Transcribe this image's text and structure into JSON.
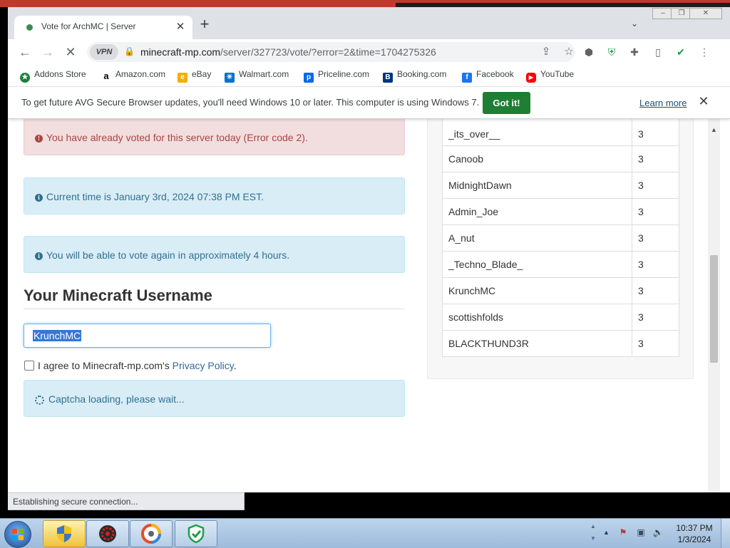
{
  "browser": {
    "tab_title": "Vote for ArchMC | Server",
    "url_domain": "minecraft-mp.com",
    "url_path": "/server/327723/vote/?error=2&time=1704275326",
    "vpn_label": "VPN",
    "status_text": "Establishing secure connection..."
  },
  "bookmarks": [
    {
      "label": "Addons Store",
      "icon": "addons-store-icon",
      "color": "#1b7f3b"
    },
    {
      "label": "Amazon.com",
      "icon": "amazon-icon",
      "color": "#000000"
    },
    {
      "label": "eBay",
      "icon": "ebay-icon",
      "color": "#e53238"
    },
    {
      "label": "Walmart.com",
      "icon": "walmart-icon",
      "color": "#0071ce"
    },
    {
      "label": "Priceline.com",
      "icon": "priceline-icon",
      "color": "#0068ef"
    },
    {
      "label": "Booking.com",
      "icon": "booking-icon",
      "color": "#003580"
    },
    {
      "label": "Facebook",
      "icon": "facebook-icon",
      "color": "#1877f2"
    },
    {
      "label": "YouTube",
      "icon": "youtube-icon",
      "color": "#ff0000"
    }
  ],
  "infobar": {
    "message": "To get future AVG Secure Browser updates, you'll need Windows 10 or later. This computer is using Windows 7.",
    "button": "Got it!",
    "link": "Learn more"
  },
  "page": {
    "error_alert": "You have already voted for this server today (Error code 2).",
    "time_alert": "Current time is January 3rd, 2024 07:38 PM EST.",
    "vote_again_alert": "You will be able to vote again in approximately 4 hours.",
    "username_heading": "Your Minecraft Username",
    "username_value": "KrunchMC",
    "agree_text": "I agree to Minecraft-mp.com's ",
    "privacy_link": "Privacy Policy",
    "agree_period": ".",
    "captcha_text": "Captcha loading, please wait..."
  },
  "voters": [
    {
      "name": "_its_over__",
      "votes": "3"
    },
    {
      "name": "Canoob",
      "votes": "3"
    },
    {
      "name": "MidnightDawn",
      "votes": "3"
    },
    {
      "name": "Admin_Joe",
      "votes": "3"
    },
    {
      "name": "A_nut",
      "votes": "3"
    },
    {
      "name": "_Techno_Blade_",
      "votes": "3"
    },
    {
      "name": "KrunchMC",
      "votes": "3"
    },
    {
      "name": "scottishfolds",
      "votes": "3"
    },
    {
      "name": "BLACKTHUND3R",
      "votes": "3"
    }
  ],
  "taskbar": {
    "time": "10:37 PM",
    "date": "1/3/2024"
  },
  "colors": {
    "accent_green": "#1e7e34",
    "danger_text": "#a94442",
    "info_text": "#31708f"
  }
}
